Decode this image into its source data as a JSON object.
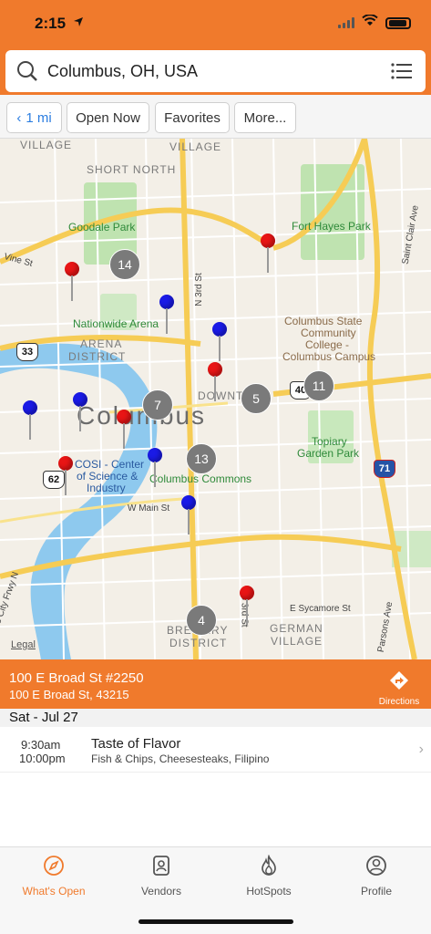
{
  "status": {
    "time": "2:15"
  },
  "search": {
    "value": "Columbus, OH, USA"
  },
  "filters": {
    "distance": "1 mi",
    "open_now": "Open Now",
    "favorites": "Favorites",
    "more": "More..."
  },
  "map": {
    "labels": {
      "village_left": "VILLAGE",
      "village_right": "VILLAGE",
      "short_north": "SHORT NORTH",
      "goodale": "Goodale Park",
      "fort_hayes": "Fort Hayes Park",
      "vine": "Vine St",
      "nationwide": "Nationwide Arena",
      "arena1": "ARENA",
      "arena2": "DISTRICT",
      "n3rd": "N 3rd St",
      "cscc1": "Columbus State",
      "cscc2": "Community",
      "cscc3": "College -",
      "cscc4": "Columbus Campus",
      "downtown": "DOWNT",
      "city": "Columbus",
      "topiary1": "Topiary",
      "topiary2": "Garden Park",
      "cosi1": "COSI - Center",
      "cosi2": "of Science &",
      "cosi3": "Industry",
      "commons": "Columbus Commons",
      "wmain": "W Main St",
      "esycamore": "E Sycamore St",
      "s3rd": "S 3rd St",
      "brewery1": "BREWERY",
      "brewery2": "DISTRICT",
      "german1": "GERMAN",
      "german2": "VILLAGE",
      "stclair": "Saint Clair Ave",
      "parsons": "Parsons Ave",
      "frwy": "s City Frwy N",
      "legal": "Legal"
    },
    "shields": {
      "us33": "33",
      "us40": "40",
      "us62": "62",
      "i71": "71"
    },
    "clusters": [
      "14",
      "7",
      "5",
      "11",
      "13",
      "4"
    ]
  },
  "selected": {
    "line1": "100 E Broad St #2250",
    "line2": "100 E Broad St, 43215",
    "directions": "Directions"
  },
  "schedule": {
    "date": "Sat - Jul 27",
    "events": [
      {
        "start": "9:30am",
        "end": "10:00pm",
        "name": "Taste of Flavor",
        "categories": "Fish & Chips, Cheesesteaks, Filipino"
      }
    ]
  },
  "tabs": [
    {
      "label": "What's Open",
      "icon": "compass-icon"
    },
    {
      "label": "Vendors",
      "icon": "vendors-icon"
    },
    {
      "label": "HotSpots",
      "icon": "flame-icon"
    },
    {
      "label": "Profile",
      "icon": "profile-icon"
    }
  ],
  "colors": {
    "accent": "#f07a2c",
    "pin_red": "#e81515",
    "pin_blue": "#1a1ae6"
  }
}
